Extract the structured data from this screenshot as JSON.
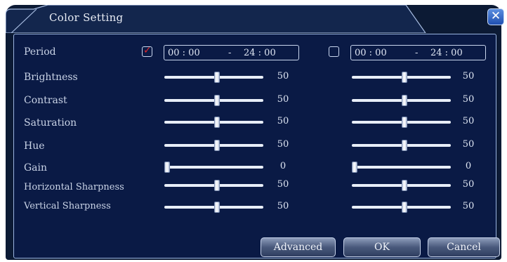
{
  "dialog": {
    "title": "Color Setting",
    "close_icon": "close-icon"
  },
  "left": {
    "period_checked": true,
    "period": {
      "start": "00 : 00",
      "separator": "-",
      "end": "24 : 00"
    }
  },
  "right": {
    "period_checked": false,
    "period": {
      "start": "00 : 00",
      "separator": "-",
      "end": "24 : 00"
    }
  },
  "rows": [
    {
      "label": "Period"
    },
    {
      "label": "Brightness",
      "left": "50",
      "right": "50",
      "left_level": 0.5,
      "right_level": 0.5
    },
    {
      "label": "Contrast",
      "left": "50",
      "right": "50",
      "left_level": 0.5,
      "right_level": 0.5
    },
    {
      "label": "Saturation",
      "left": "50",
      "right": "50",
      "left_level": 0.5,
      "right_level": 0.5
    },
    {
      "label": "Hue",
      "left": "50",
      "right": "50",
      "left_level": 0.5,
      "right_level": 0.5
    },
    {
      "label": "Gain",
      "left": "0",
      "right": "0",
      "left_level": 0.0,
      "right_level": 0.0
    },
    {
      "label": "Horizontal Sharpness",
      "left": "50",
      "right": "50",
      "left_level": 0.5,
      "right_level": 0.5
    },
    {
      "label": "Vertical Sharpness",
      "left": "50",
      "right": "50",
      "left_level": 0.5,
      "right_level": 0.5
    }
  ],
  "buttons": {
    "advanced": "Advanced",
    "ok": "OK",
    "cancel": "Cancel"
  },
  "colors": {
    "background": "#0c1a34",
    "panel": "#0a1a45",
    "text": "#c9d3e6",
    "check_mark": "#e3262b"
  }
}
